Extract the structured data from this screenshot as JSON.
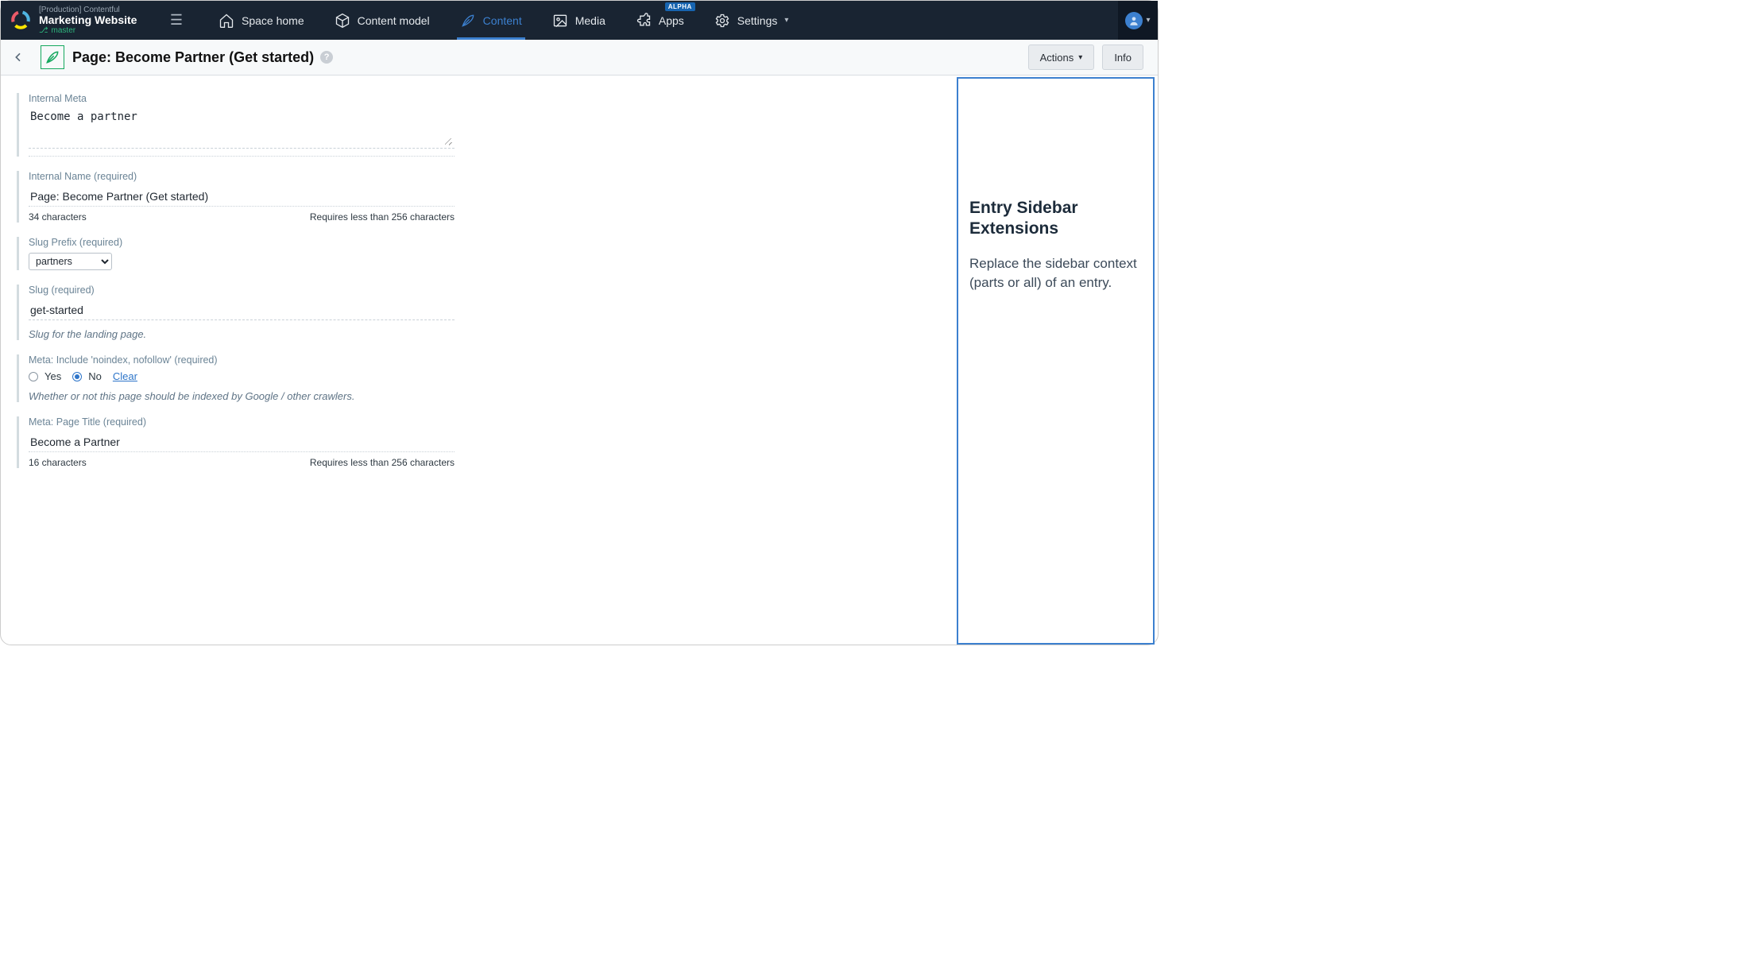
{
  "brand": {
    "env": "[Production] Contentful",
    "name": "Marketing Website",
    "branch": "master"
  },
  "nav": {
    "items": [
      {
        "label": "Space home"
      },
      {
        "label": "Content model"
      },
      {
        "label": "Content"
      },
      {
        "label": "Media"
      },
      {
        "label": "Apps",
        "badge": "ALPHA"
      },
      {
        "label": "Settings"
      }
    ]
  },
  "header": {
    "title": "Page: Become Partner (Get started)",
    "actions_label": "Actions",
    "info_label": "Info"
  },
  "fields": {
    "internal_meta": {
      "label": "Internal Meta",
      "value": "Become a partner"
    },
    "internal_name": {
      "label": "Internal Name (required)",
      "value": "Page: Become Partner (Get started)",
      "count": "34 characters",
      "limit": "Requires less than 256 characters"
    },
    "slug_prefix": {
      "label": "Slug Prefix (required)",
      "value": "partners"
    },
    "slug": {
      "label": "Slug (required)",
      "value": "get-started",
      "help": "Slug for the landing page."
    },
    "noindex": {
      "label": "Meta: Include 'noindex, nofollow' (required)",
      "yes": "Yes",
      "no": "No",
      "selected": "No",
      "clear": "Clear",
      "help": "Whether or not this page should be indexed by Google / other crawlers."
    },
    "page_title": {
      "label": "Meta: Page Title (required)",
      "value": "Become a Partner",
      "count": "16 characters",
      "limit": "Requires less than 256 characters"
    }
  },
  "sidebar": {
    "title": "Entry Sidebar Extensions",
    "body": "Replace the sidebar context (parts or all) of an entry."
  }
}
